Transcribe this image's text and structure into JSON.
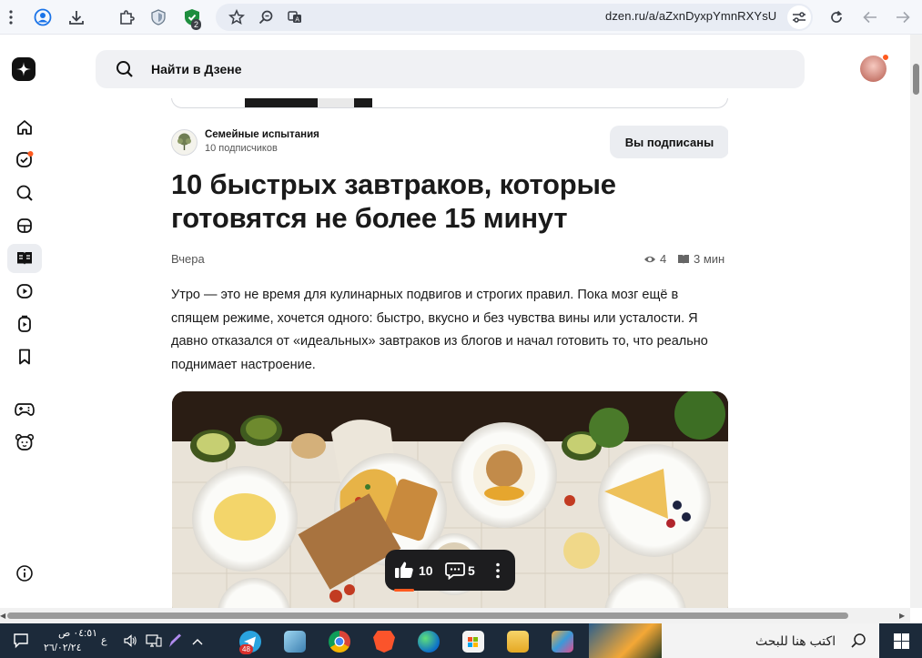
{
  "browser": {
    "url": "dzen.ru/a/aZxnDyxpYmnRXYsU",
    "extension_badge": "2"
  },
  "header": {
    "search_label": "Найти в Дзене"
  },
  "article": {
    "channel_name": "Семейные испытания",
    "channel_subscribers": "10 подписчиков",
    "subscribe_label": "Вы подписаны",
    "title": "10 быстрых завтраков, которые готовятся не более 15 минут",
    "date": "Вчера",
    "views": "4",
    "read_time": "3 мин",
    "body": "Утро — это не время для кулинарных подвигов и строгих правил. Пока мозг ещё в спящем режиме, хочется одного: быстро, вкусно и без чувства вины или усталости. Я давно отказался от «идеальных» завтраков из блогов и начал готовить то, что реально поднимает настроение."
  },
  "actions": {
    "likes": "10",
    "comments": "5"
  },
  "taskbar": {
    "search_placeholder": "اكتب هنا للبحث",
    "time": "٠٤:٥١ ص",
    "date": "٢٦/٠٢/٢٤",
    "lang": "ع",
    "telegram_badge": "48"
  },
  "colors": {
    "accent": "#ff5a1f",
    "action_bar": "#1d1d1f",
    "taskbar": "#1c2a3a"
  }
}
